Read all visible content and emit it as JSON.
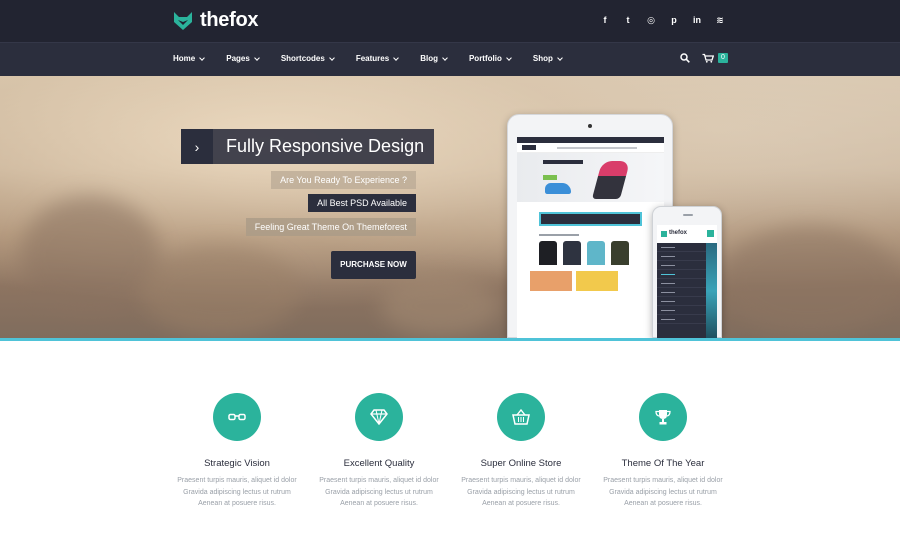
{
  "brand": {
    "name_prefix": "the",
    "name_suffix": "fox",
    "accent": "#2bb39c",
    "dark": "#222431"
  },
  "social_icons": [
    "facebook-icon",
    "twitter-icon",
    "dribbble-icon",
    "pinterest-icon",
    "linkedin-icon",
    "rss-icon"
  ],
  "social_glyphs": [
    "f",
    "t",
    "◎",
    "p",
    "in",
    "≋"
  ],
  "nav": {
    "items": [
      {
        "label": "Home"
      },
      {
        "label": "Pages"
      },
      {
        "label": "Shortcodes"
      },
      {
        "label": "Features"
      },
      {
        "label": "Blog"
      },
      {
        "label": "Portfolio"
      },
      {
        "label": "Shop"
      }
    ],
    "cart_count": "0"
  },
  "hero": {
    "title": "Fully Responsive Design",
    "tagline_1": "Are You Ready To Experience ?",
    "tagline_2": "All Best PSD Available",
    "tagline_3": "Feeling Great Theme On Themeforest",
    "button_label": "PURCHASE NOW",
    "accent_line": "#4fc3d8"
  },
  "features": [
    {
      "icon": "glasses-icon",
      "title": "Strategic Vision",
      "desc_1": "Praesent turpis mauris, aliquet id dolor",
      "desc_2": "Gravida adipiscing lectus ut rutrum",
      "desc_3": "Aenean at posuere risus."
    },
    {
      "icon": "diamond-icon",
      "title": "Excellent Quality",
      "desc_1": "Praesent turpis mauris, aliquet id dolor",
      "desc_2": "Gravida adipiscing lectus ut rutrum",
      "desc_3": "Aenean at posuere risus."
    },
    {
      "icon": "basket-icon",
      "title": "Super Online Store",
      "desc_1": "Praesent turpis mauris, aliquet id dolor",
      "desc_2": "Gravida adipiscing lectus ut rutrum",
      "desc_3": "Aenean at posuere risus."
    },
    {
      "icon": "trophy-icon",
      "title": "Theme Of The Year",
      "desc_1": "Praesent turpis mauris, aliquet id dolor",
      "desc_2": "Gravida adipiscing lectus ut rutrum",
      "desc_3": "Aenean at posuere risus."
    }
  ]
}
